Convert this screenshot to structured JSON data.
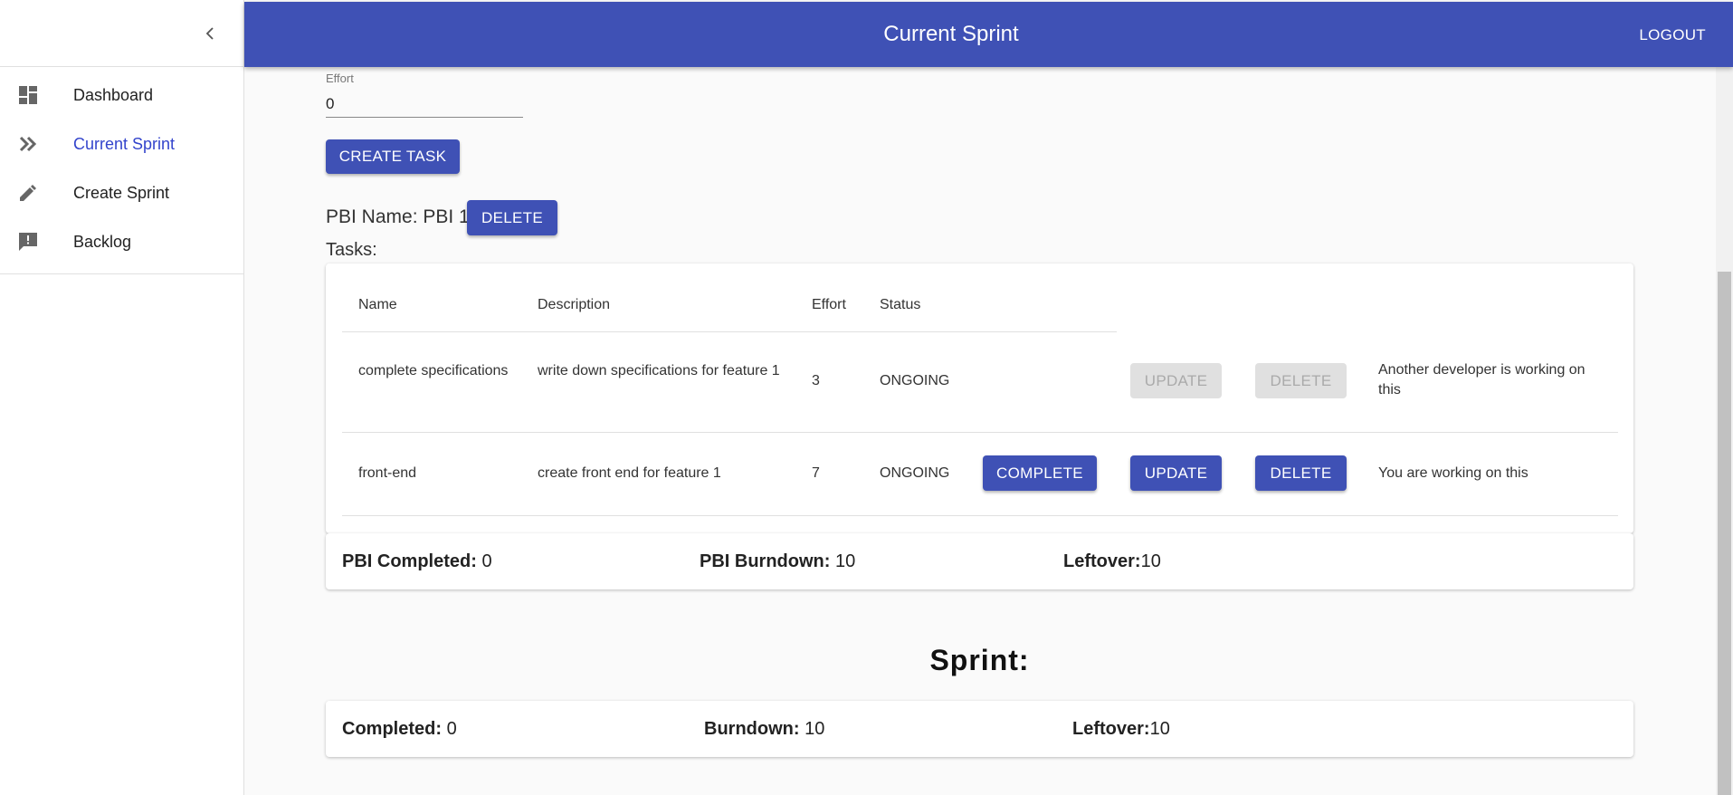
{
  "header": {
    "title": "Current Sprint",
    "logout_label": "LOGOUT"
  },
  "sidebar": {
    "items": [
      {
        "label": "Dashboard",
        "icon": "dashboard-icon"
      },
      {
        "label": "Current Sprint",
        "icon": "double-chevron-icon"
      },
      {
        "label": "Create Sprint",
        "icon": "pencil-icon"
      },
      {
        "label": "Backlog",
        "icon": "feedback-icon"
      }
    ],
    "active": "Current Sprint"
  },
  "form": {
    "effort_label": "Effort",
    "effort_value": "0",
    "create_task_label": "CREATE TASK"
  },
  "pbi": {
    "name_label": "PBI Name: PBI 1",
    "delete_label": "DELETE",
    "tasks_label": "Tasks:"
  },
  "table": {
    "columns": [
      "Name",
      "Description",
      "Effort",
      "Status"
    ],
    "rows": [
      {
        "name": "complete specifications",
        "description": "write down specifications for feature 1",
        "effort": "3",
        "status": "ONGOING",
        "update_label": "UPDATE",
        "delete_label": "DELETE",
        "note": "Another developer is working on this"
      },
      {
        "name": "front-end",
        "description": "create front end for feature 1",
        "effort": "7",
        "status": "ONGOING",
        "complete_label": "COMPLETE",
        "update_label": "UPDATE",
        "delete_label": "DELETE",
        "note": "You are working on this"
      }
    ]
  },
  "pbi_stats": {
    "completed_label": "PBI Completed:",
    "completed_value": "0",
    "burndown_label": "PBI Burndown:",
    "burndown_value": "10",
    "leftover_label": "Leftover:",
    "leftover_value": "10"
  },
  "sprint": {
    "title": "Sprint:",
    "completed_label": "Completed:",
    "completed_value": "0",
    "burndown_label": "Burndown:",
    "burndown_value": "10",
    "leftover_label": "Leftover:",
    "leftover_value": "10"
  },
  "colors": {
    "primary": "#3f51b5",
    "active_nav": "#3344cc",
    "disabled_bg": "#e0e0e0"
  }
}
